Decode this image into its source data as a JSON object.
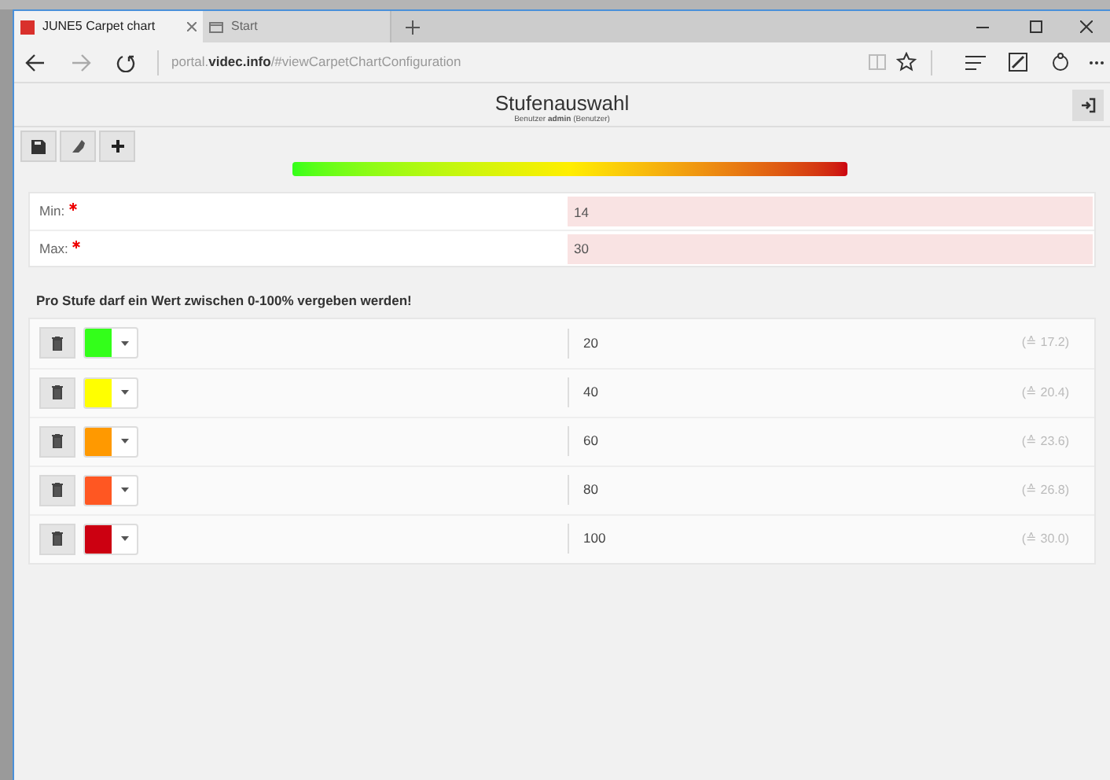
{
  "browser": {
    "tabs": [
      {
        "label": "JUNE5 Carpet chart",
        "selected": true
      },
      {
        "label": "Start",
        "selected": false
      }
    ],
    "address": "portal.**videc.info**/#viewCarpetChartConfiguration"
  },
  "header": {
    "title": "Stufenauswahl",
    "subtitle": "Benutzer **admin** (Benutzer)"
  },
  "fields": [
    {
      "label": "Min:",
      "required": true,
      "value": "14"
    },
    {
      "label": "Max:",
      "required": true,
      "value": "30"
    }
  ],
  "notice": "Pro Stufe darf ein Wert zwischen 0-100% vergeben werden!",
  "stages": [
    {
      "color": "#33ff1a",
      "value": "20",
      "equivalent": "(≙ 17.2)"
    },
    {
      "color": "#ffff00",
      "value": "40",
      "equivalent": "(≙ 20.4)"
    },
    {
      "color": "#ff9900",
      "value": "60",
      "equivalent": "(≙ 23.6)"
    },
    {
      "color": "#ff5722",
      "value": "80",
      "equivalent": "(≙ 26.8)"
    },
    {
      "color": "#cc0011",
      "value": "100",
      "equivalent": "(≙ 30.0)"
    }
  ]
}
